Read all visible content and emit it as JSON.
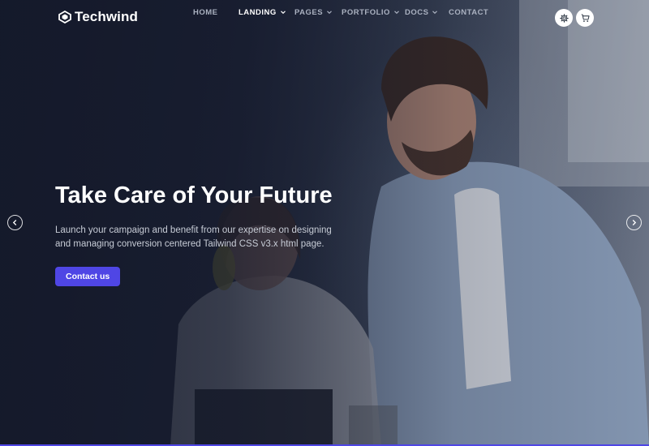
{
  "brand": {
    "name": "Techwind",
    "logo_icon": "techwind-logo-icon"
  },
  "nav": {
    "items": [
      {
        "label": "HOME",
        "has_dropdown": false,
        "active": false
      },
      {
        "label": "LANDING",
        "has_dropdown": true,
        "active": true
      },
      {
        "label": "PAGES",
        "has_dropdown": true,
        "active": false
      },
      {
        "label": "PORTFOLIO",
        "has_dropdown": true,
        "active": false
      },
      {
        "label": "DOCS",
        "has_dropdown": true,
        "active": false
      },
      {
        "label": "CONTACT",
        "has_dropdown": false,
        "active": false
      }
    ],
    "actions": [
      {
        "icon": "gear-icon"
      },
      {
        "icon": "cart-icon"
      }
    ]
  },
  "hero": {
    "title": "Take Care of Your Future",
    "description": "Launch your campaign and benefit from our expertise on designing and managing conversion centered Tailwind CSS v3.x html page.",
    "cta_label": "Contact us",
    "prev_icon": "chevron-left-icon",
    "next_icon": "chevron-right-icon"
  },
  "colors": {
    "accent": "#4f46e5",
    "overlay": "#14192a",
    "text_light": "#c7ccd6"
  }
}
